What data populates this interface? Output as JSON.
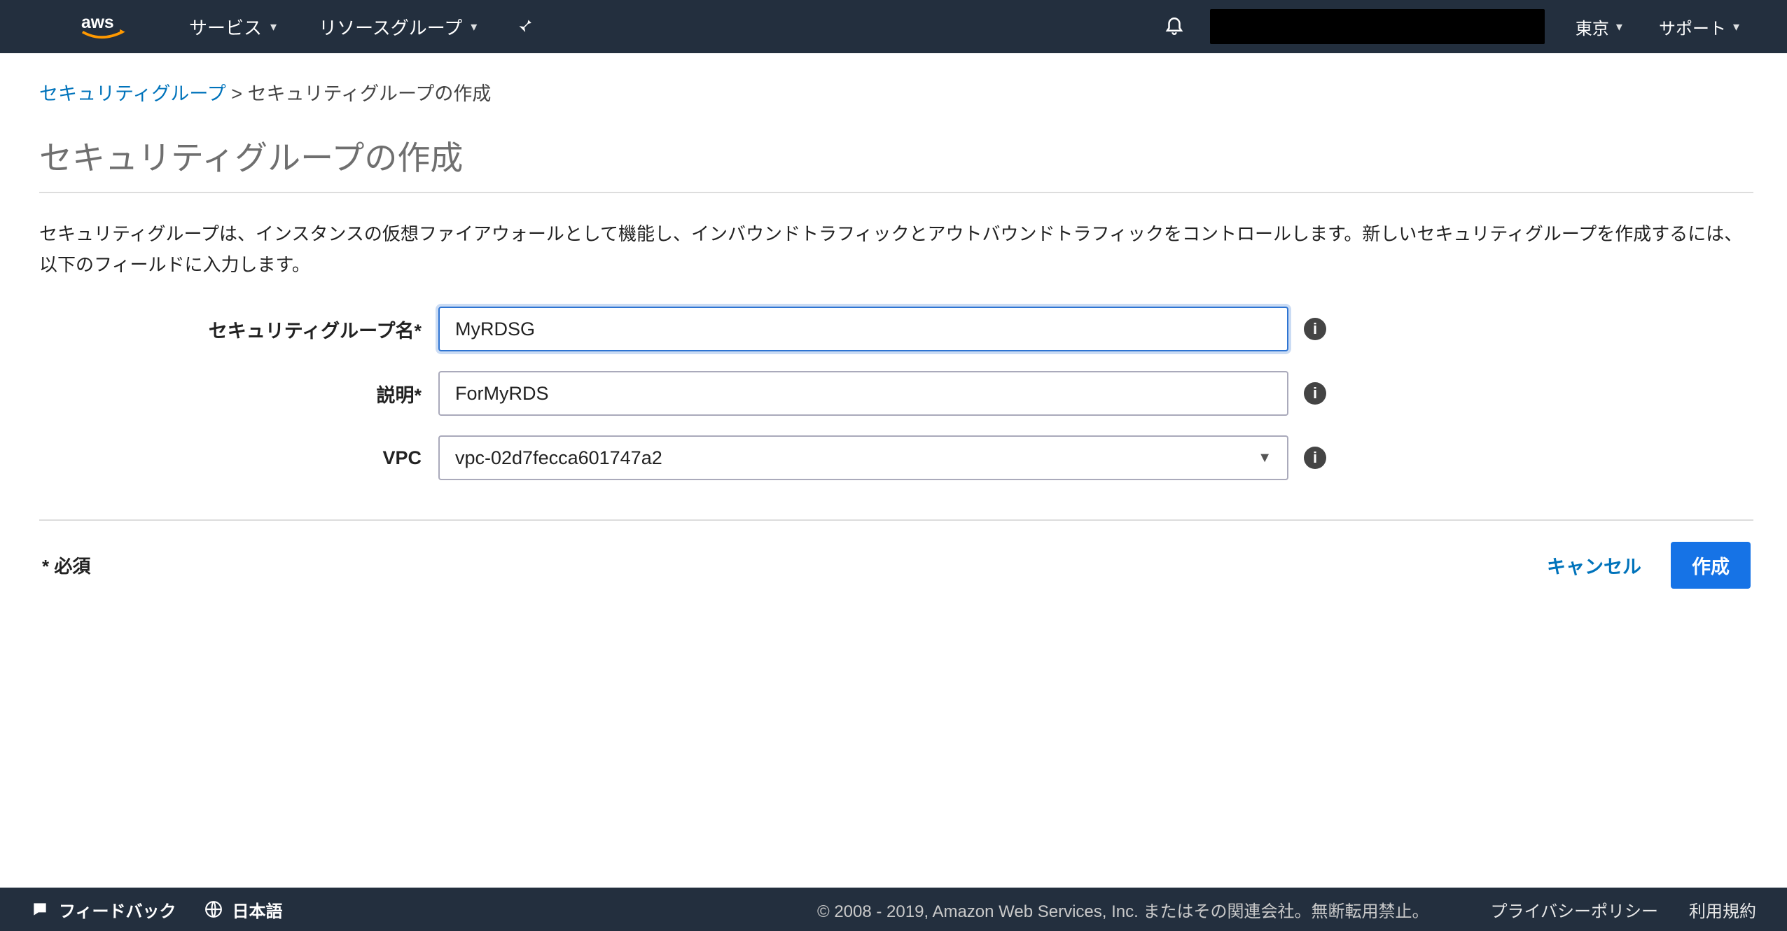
{
  "topnav": {
    "services_label": "サービス",
    "resource_groups_label": "リソースグループ",
    "region_label": "東京",
    "support_label": "サポート"
  },
  "breadcrumb": {
    "parent": "セキュリティグループ",
    "current": "セキュリティグループの作成"
  },
  "page": {
    "title": "セキュリティグループの作成",
    "description": "セキュリティグループは、インスタンスの仮想ファイアウォールとして機能し、インバウンドトラフィックとアウトバウンドトラフィックをコントロールします。新しいセキュリティグループを作成するには、以下のフィールドに入力します。"
  },
  "form": {
    "name_label": "セキュリティグループ名*",
    "name_value": "MyRDSG",
    "desc_label": "説明*",
    "desc_value": "ForMyRDS",
    "vpc_label": "VPC",
    "vpc_value": "vpc-02d7fecca601747a2"
  },
  "actions": {
    "required_note": "* 必須",
    "cancel_label": "キャンセル",
    "create_label": "作成"
  },
  "bottombar": {
    "feedback_label": "フィードバック",
    "language_label": "日本語",
    "copyright": "© 2008 - 2019, Amazon Web Services, Inc. またはその関連会社。無断転用禁止。",
    "privacy_label": "プライバシーポリシー",
    "terms_label": "利用規約"
  }
}
